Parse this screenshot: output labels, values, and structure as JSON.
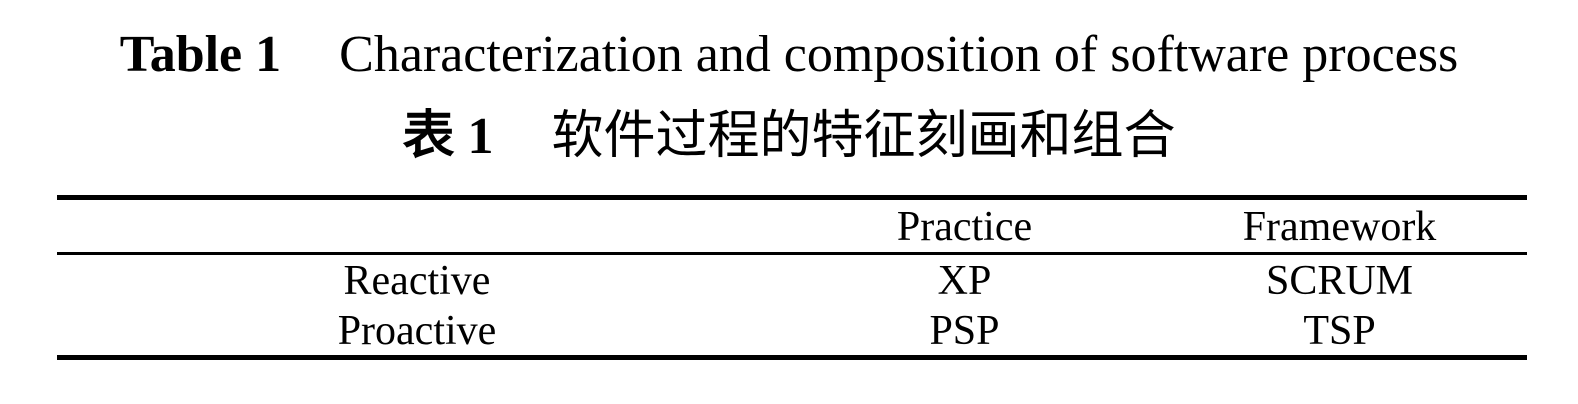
{
  "caption": {
    "en_label": "Table 1",
    "en_title": "Characterization and composition of software process",
    "zh_label": "表 1",
    "zh_title": "软件过程的特征刻画和组合"
  },
  "table": {
    "headers": [
      "",
      "Practice",
      "Framework"
    ],
    "rows": [
      [
        "Reactive",
        "XP",
        "SCRUM"
      ],
      [
        "Proactive",
        "PSP",
        "TSP"
      ]
    ]
  }
}
